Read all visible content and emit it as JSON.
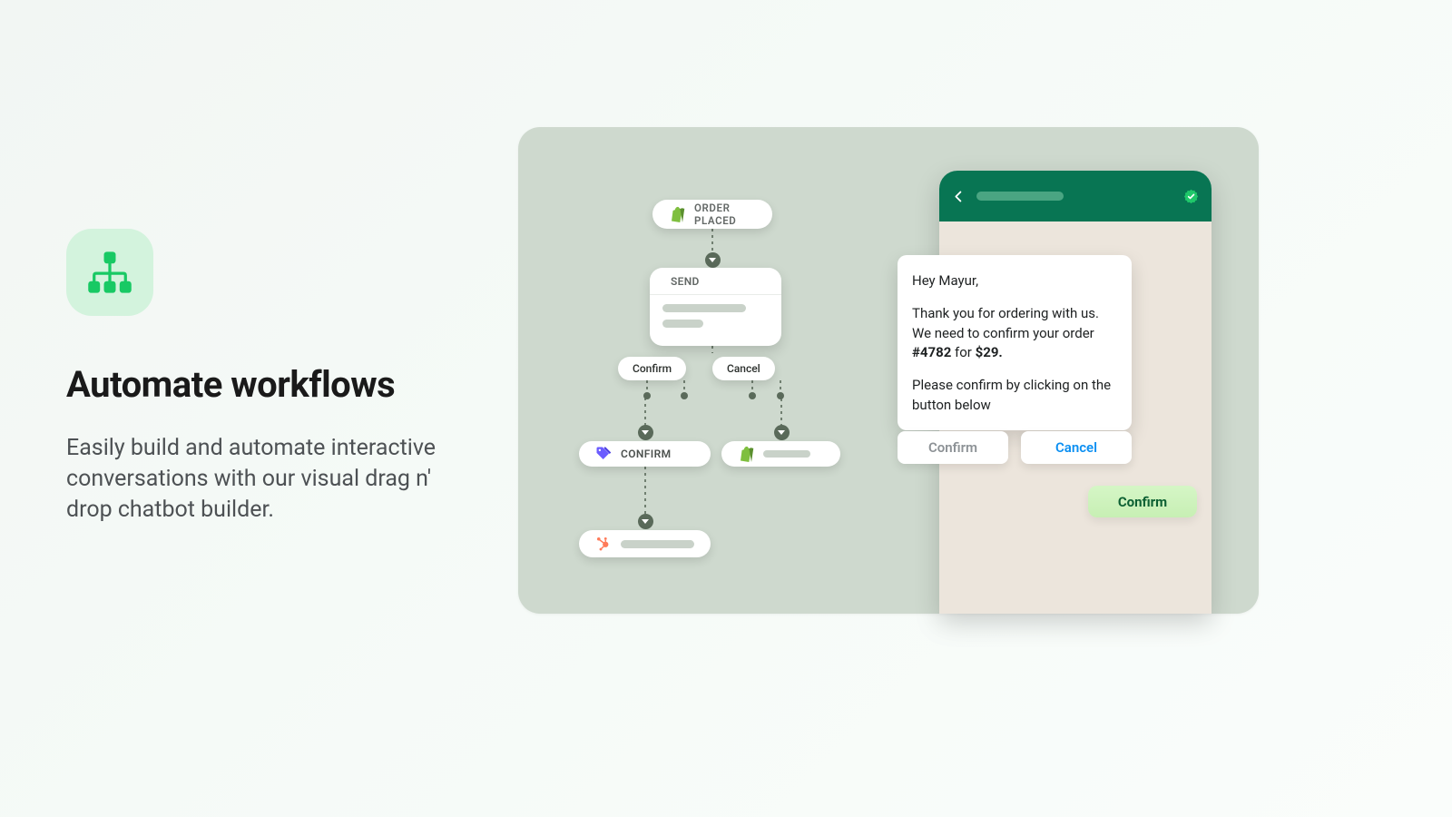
{
  "hero": {
    "title": "Automate workflows",
    "description": "Easily build and automate interactive conversations with our visual drag n' drop chatbot builder."
  },
  "flow": {
    "orderPlaced": "ORDER PLACED",
    "send": "SEND",
    "confirmBtn": "Confirm",
    "cancelBtn": "Cancel",
    "confirmNode": "CONFIRM"
  },
  "chat": {
    "greeting": "Hey Mayur,",
    "body1": "Thank you for ordering with us. We need to confirm your order ",
    "orderNo": "#4782",
    "bodyMid": " for ",
    "price": "$29.",
    "body2": "Please confirm by clicking on the button below",
    "replyConfirm": "Confirm",
    "replyCancel": "Cancel",
    "userReply": "Confirm"
  },
  "colors": {
    "accent": "#18c964",
    "phoneHeader": "#087553"
  }
}
